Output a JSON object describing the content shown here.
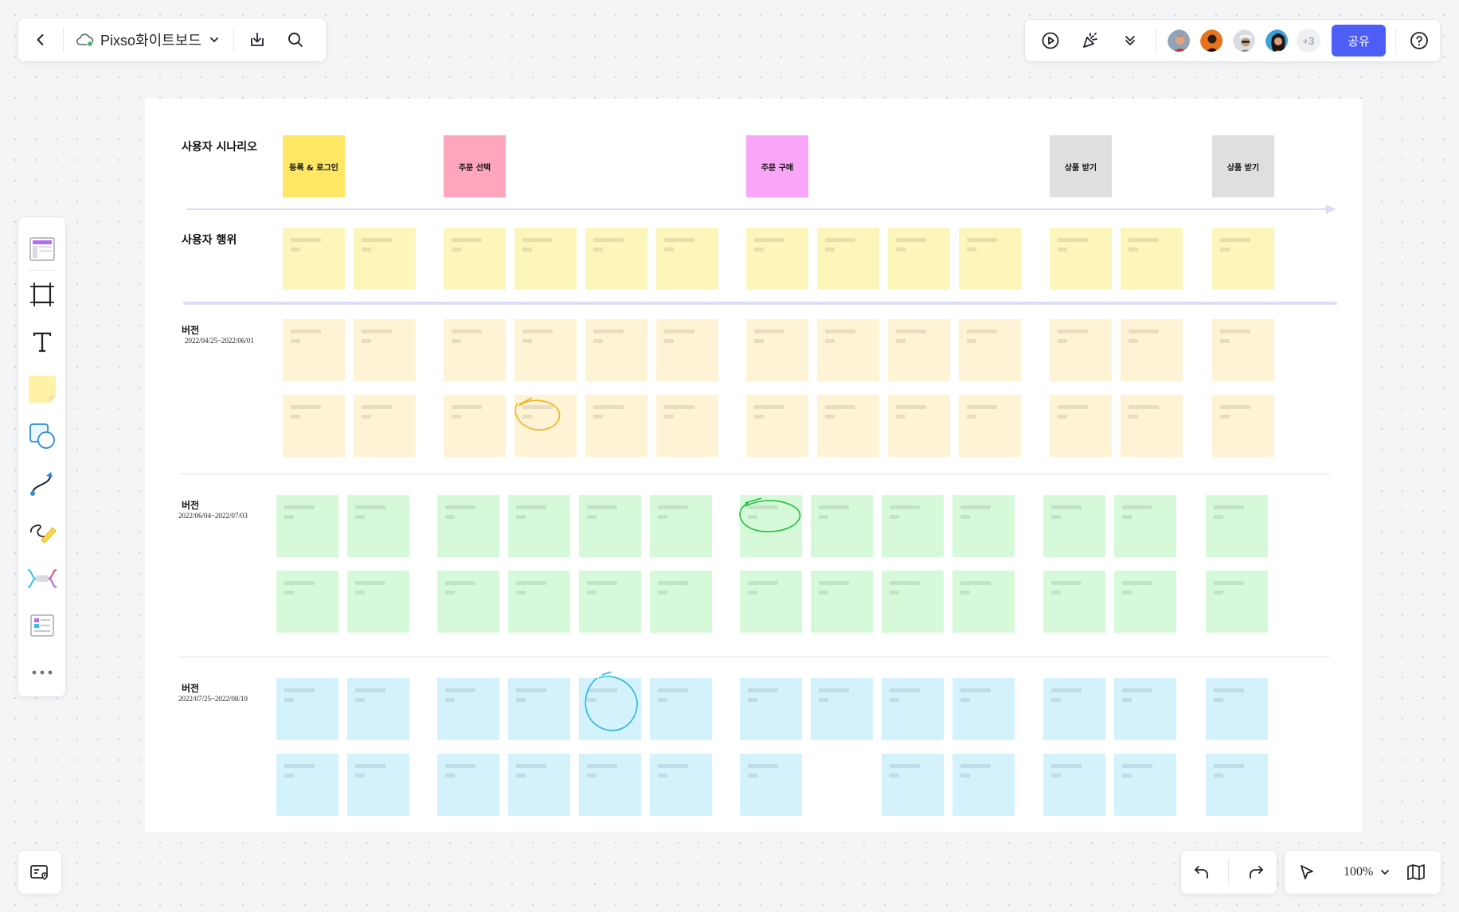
{
  "topbar": {
    "file_name": "Pixso화이트보드",
    "icons": [
      "back-icon",
      "cloud-saved-icon",
      "chevron-down-icon",
      "download-icon",
      "search-icon"
    ]
  },
  "collab": {
    "extra_count": "+3",
    "share_label": "공유",
    "icons": [
      "present-icon",
      "celebrate-icon",
      "collapse-icon",
      "help-icon"
    ]
  },
  "toolbar": {
    "tools": [
      "template-icon",
      "frame-icon",
      "text-icon",
      "sticky-note-icon",
      "shape-icon",
      "connector-icon",
      "pen-icon",
      "mindmap-icon",
      "widget-icon",
      "more-icon"
    ]
  },
  "bottom": {
    "zoom": "100%",
    "icons": [
      "minimap-icon",
      "undo-icon",
      "redo-icon",
      "select-pointer-icon",
      "chevron-down-icon",
      "map-icon"
    ]
  },
  "board": {
    "scenario_label": "사용자 시나리오",
    "behavior_label": "사용자 행위",
    "scenario_notes": [
      {
        "label": "등록 & 로그인",
        "color": "#ffe766"
      },
      {
        "label": "주문 선택",
        "color": "#ffa6bd"
      },
      {
        "label": "주문 구매",
        "color": "#f9a6f9"
      },
      {
        "label": "상품 받기",
        "color": "#dfdfe1"
      },
      {
        "label": "상품 받기",
        "color": "#dfdfe1"
      }
    ],
    "versions": [
      {
        "title": "버전",
        "date": "2022/04/25~2022/06/01",
        "color": "#fff3d5"
      },
      {
        "title": "버전",
        "date": "2022/06/04~2022/07/03",
        "color": "#d6fad9"
      },
      {
        "title": "버전",
        "date": "2022/07/25~2022/08/10",
        "color": "#d3f2fc"
      }
    ],
    "behavior_color": "#fdf6bb",
    "timeline_color": "#dddcf6"
  }
}
